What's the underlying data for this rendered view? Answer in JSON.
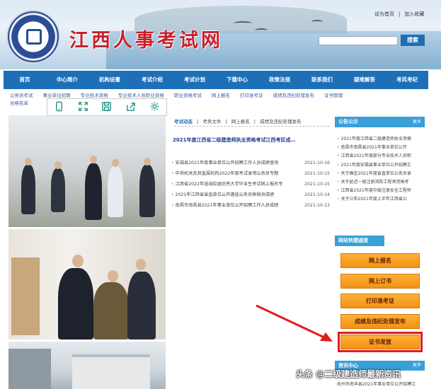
{
  "header": {
    "site_title": "江西人事考试网",
    "top_links": [
      "设为首页",
      "|",
      "加入收藏"
    ],
    "search_button": "搜索"
  },
  "nav": [
    "首页",
    "中心简介",
    "机构设置",
    "考试介绍",
    "考试计划",
    "下载中心",
    "政策法规",
    "联系我们",
    "疑难解答",
    "考风考纪"
  ],
  "subnav": {
    "row1": [
      "公务员考试",
      "事业单位招聘",
      "专业技术资格",
      "专业技术人员职业资格",
      "职业资格考试",
      "网上报名",
      "打印准考证",
      "成绩及违纪处理发布",
      "证书管理"
    ],
    "row2": [
      "合格名单"
    ]
  },
  "toolbar_icons": [
    "phone-icon",
    "expand-icon",
    "save-icon",
    "share-icon",
    "settings-icon"
  ],
  "news": {
    "tabs": [
      "考试动态",
      "|",
      "考务文件",
      "|",
      "网上报名",
      "|",
      "成绩及违纪处理发布"
    ],
    "headline": "2021年度江西省二级建造师执业资格考试江西考区成…",
    "items": [
      {
        "title": "安福县2021年度事业单位公开招聘工作人员成绩查询",
        "date": "2021-10-16"
      },
      {
        "title": "中央机关及其直属机构2022年度考试录用公务员专题",
        "date": "2021-10-15"
      },
      {
        "title": "江西省2022年选调应届优秀大学毕业生考试网上报名专",
        "date": "2021-10-15"
      },
      {
        "title": "2021年江西省省直单位公开遴选公务员联络员成绩",
        "date": "2021-10-14"
      },
      {
        "title": "南昌市南昌县2021年事业单位公开招聘工作人员成绩",
        "date": "2021-10-13"
      }
    ]
  },
  "notice": {
    "title": "公告公示",
    "more": "更多",
    "items": [
      "2021年度江西省二级建造师执业资格",
      "南昌市南昌县2021年事业单位公开",
      "江西省2021年度部分专业技术人员职",
      "2021年度安福县事业单位公开招聘工",
      "关于确定2021年度省直单位公务员录",
      "关于延迟一级注册消防工程师资格考",
      "江西省2021年度中级注册安全工程师",
      "关于公布2021年度上半年江西省公"
    ]
  },
  "quick": {
    "title": "网站快捷通道",
    "buttons": [
      "网上报名",
      "网上订书",
      "打印准考证",
      "成绩及违纪处理发布",
      "证书发放"
    ]
  },
  "bottom": {
    "title": "资讯中心",
    "more": "更多",
    "item": "抚州市南丰县2021年事业单位公开招聘工"
  },
  "watermark": "头条 @二级建造师最新资讯",
  "colors": {
    "nav": "#1d6fb8",
    "accent": "#39a0d8",
    "button": "#f39214",
    "highlight": "#e51b1b"
  }
}
